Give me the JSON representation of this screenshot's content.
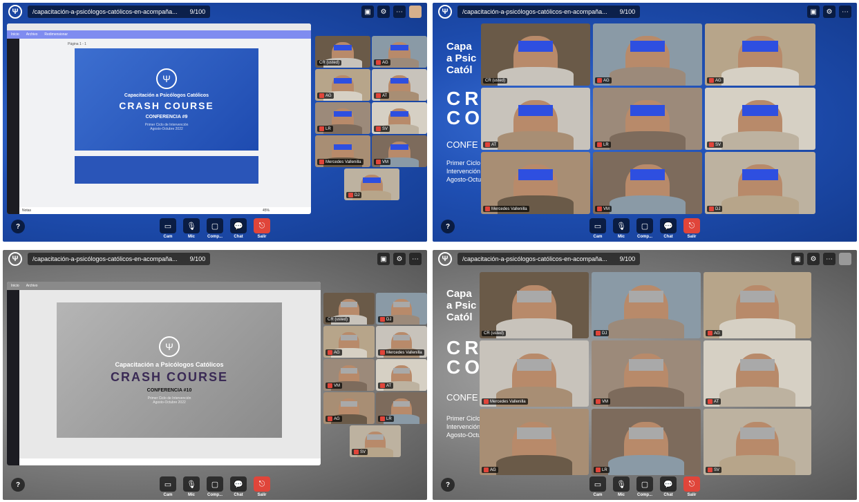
{
  "room": {
    "name": "/capacitación-a-psicólogos-católicos-en-acompaña...",
    "count": "9/100"
  },
  "controls": [
    "Cam",
    "Mic",
    "Comp...",
    "Chat",
    "Salir"
  ],
  "help_label": "?",
  "slide": {
    "title": "Capacitación a Psicólogos Católicos",
    "course": "CRASH COURSE",
    "conf1": "CONFERENCIA #9",
    "conf2": "CONFERENCIA #10",
    "subtitle1": "Primer Ciclo de Intervención",
    "subtitle2": "Agosto-Octubre 2022",
    "page_label": "Página 1 - 1",
    "notes_label": "Notas",
    "zoom": "45%"
  },
  "background_text": {
    "cap": "Capa\na Psic\nCatól",
    "cr": "CR\nCOU",
    "conf": "CONFE",
    "primer": "Primer Ciclo\nIntervención\nAgosto-Octub"
  },
  "panel1_tiles": [
    "CR (usted)",
    "AG",
    "AG",
    "AT",
    "LR",
    "SV",
    "Mercedes Vallenilla",
    "VM",
    "DJ"
  ],
  "panel2_tiles": [
    "CR (usted)",
    "AG",
    "AG",
    "AT",
    "LR",
    "SV",
    "Mercedes Vallenilla",
    "VM",
    "DJ"
  ],
  "panel3_tiles": [
    "CR (usted)",
    "DJ",
    "AG",
    "Mercedes Vallenilla",
    "VM",
    "AT",
    "AG",
    "LR",
    "SV"
  ],
  "panel4_tiles": [
    "CR (usted)",
    "DJ",
    "AG",
    "Mercedes Vallenilla",
    "VM",
    "AT",
    "AG",
    "LR",
    "SV"
  ]
}
